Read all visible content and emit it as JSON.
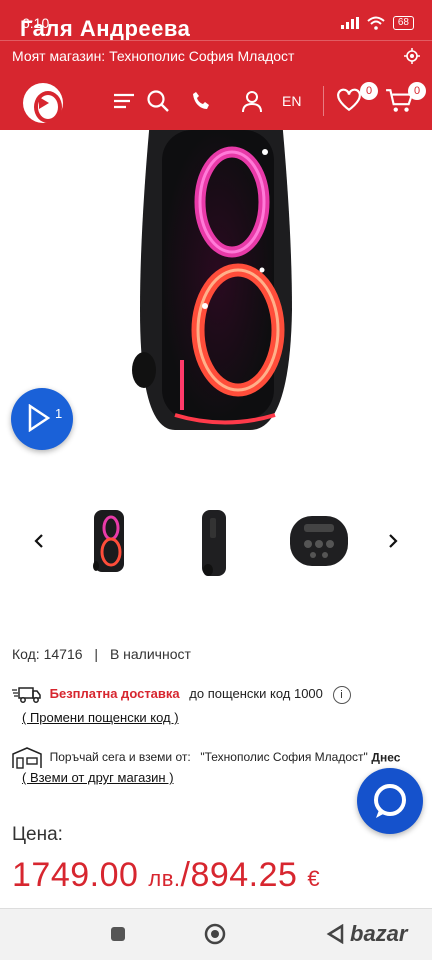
{
  "status": {
    "time": "6:10",
    "name": "Галя Андреева",
    "battery": "68"
  },
  "store": {
    "label": "Моят магазин: Технополис София Младост"
  },
  "nav": {
    "lang": "EN",
    "wishlist_count": "0",
    "cart_count": "0"
  },
  "gallery": {
    "play_count": "1"
  },
  "product": {
    "code": "Код: 14716",
    "separator": "|",
    "availability": "В наличност",
    "delivery_title": "Безплатна доставка",
    "delivery_text": "до пощенски код 1000",
    "delivery_info": "i",
    "change_postal": "( Промени пощенски код )",
    "pickup_text": "Поръчай сега и вземи от:",
    "pickup_store": "\"Технополис София Младост\"",
    "pickup_when": "Днес",
    "other_store": "( Вземи от друг магазин )",
    "price_label": "Цена:",
    "price_bgn": "1749.00",
    "cur_bgn": "лв.",
    "price_sep": "/",
    "price_eur": "894.25",
    "cur_eur": "€"
  },
  "watermark": "bazar"
}
